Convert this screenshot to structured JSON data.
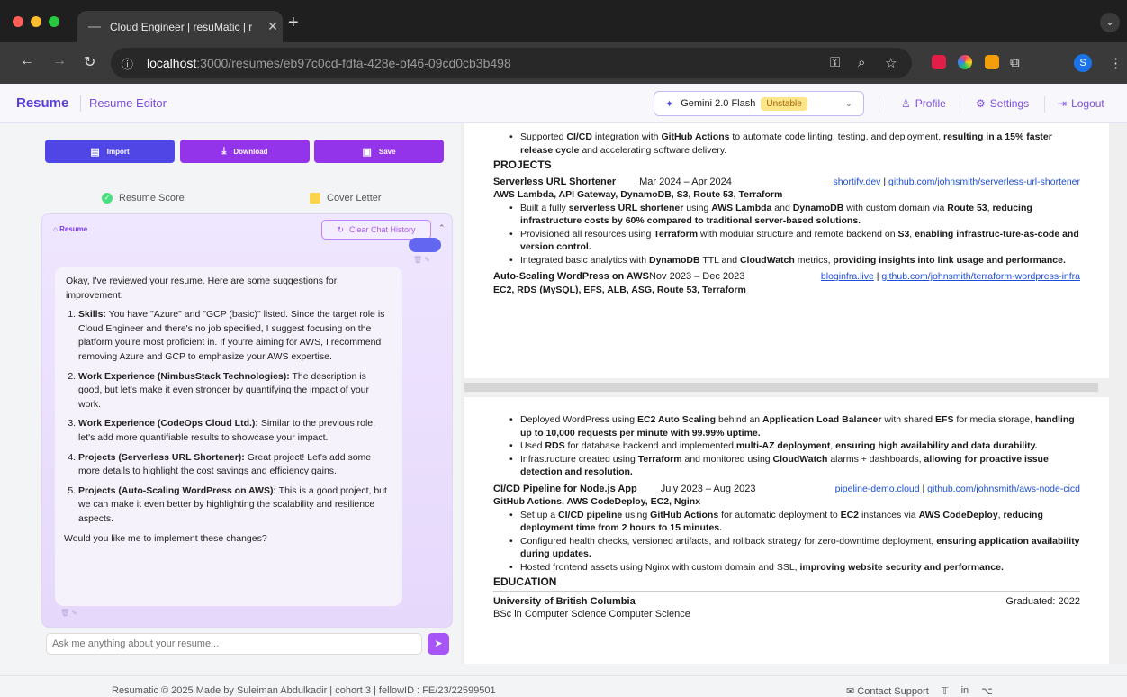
{
  "browser": {
    "tab_title": "Cloud Engineer | resuMatic | r",
    "url_host": "localhost",
    "url_path": ":3000/resumes/eb97c0cd-fdfa-428e-bf46-09cd0cb3b498",
    "profile_initial": "S"
  },
  "header": {
    "brand": "Resume",
    "subtitle": "Resume Editor",
    "model": "Gemini 2.0 Flash",
    "model_badge": "Unstable",
    "profile": "Profile",
    "settings": "Settings",
    "logout": "Logout"
  },
  "toolbar": {
    "import": "Import",
    "download": "Download",
    "save": "Save"
  },
  "subtabs": {
    "score": "Resume Score",
    "cover": "Cover Letter"
  },
  "chat": {
    "title": "Resume",
    "clear": "Clear Chat History",
    "intro": "Okay, I've reviewed your resume. Here are some suggestions for improvement:",
    "items": [
      {
        "head": "Skills:",
        "text": " You have \"Azure\" and \"GCP (basic)\" listed. Since the target role is Cloud Engineer and there's no job specified, I suggest focusing on the platform you're most proficient in. If you're aiming for AWS, I recommend removing Azure and GCP to emphasize your AWS expertise."
      },
      {
        "head": "Work Experience (NimbusStack Technologies):",
        "text": " The description is good, but let's make it even stronger by quantifying the impact of your work."
      },
      {
        "head": "Work Experience (CodeOps Cloud Ltd.):",
        "text": " Similar to the previous role, let's add more quantifiable results to showcase your impact."
      },
      {
        "head": "Projects (Serverless URL Shortener):",
        "text": " Great project! Let's add some more details to highlight the cost savings and efficiency gains."
      },
      {
        "head": "Projects (Auto-Scaling WordPress on AWS):",
        "text": " This is a good project, but we can make it even better by highlighting the scalability and resilience aspects."
      }
    ],
    "outro": "Would you like me to implement these changes?",
    "placeholder": "Ask me anything about your resume..."
  },
  "resume": {
    "top_bullet_a": "Supported ",
    "top_bullet_b": "CI/CD",
    "top_bullet_c": " integration with ",
    "top_bullet_d": "GitHub Actions",
    "top_bullet_e": " to automate code linting, testing, and deployment, ",
    "top_bullet_f": "resulting in a 15% faster release cycle",
    "top_bullet_g": " and accelerating software delivery.",
    "projects_heading": "PROJECTS",
    "p1_name": "Serverless URL Shortener",
    "p1_dates": "Mar 2024 – Apr 2024",
    "p1_link1": "shortify.dev",
    "p1_link2": "github.com/johnsmith/serverless-url-shortener",
    "p1_tech": "AWS Lambda, API Gateway, DynamoDB, S3, Route 53, Terraform",
    "p2_name": "Auto-Scaling WordPress on AWS",
    "p2_dates": "Nov 2023 – Dec 2023",
    "p2_link1": "bloginfra.live",
    "p2_link2": "github.com/johnsmith/terraform-wordpress-infra",
    "p2_tech": "EC2, RDS (MySQL), EFS, ALB, ASG, Route 53, Terraform",
    "p3_name": "CI/CD Pipeline for Node.js App",
    "p3_dates": "July 2023 – Aug 2023",
    "p3_link1": "pipeline-demo.cloud",
    "p3_link2": "github.com/johnsmith/aws-node-cicd",
    "p3_tech": "GitHub Actions, AWS CodeDeploy, EC2, Nginx",
    "link_sep": " | ",
    "education_heading": "EDUCATION",
    "school": "University of British Columbia",
    "graduated": "Graduated: 2022",
    "degree": "BSc in Computer Science Computer Science"
  },
  "footer": {
    "left": "Resumatic © 2025   Made by Suleiman Abdulkadir | cohort 3 | fellowID : FE/23/22599501",
    "contact": "Contact Support"
  },
  "colors": {
    "import_btn": "#4f46e5",
    "download_btn": "#9333ea",
    "save_btn": "#9333ea",
    "brand": "#5b3fd6"
  }
}
